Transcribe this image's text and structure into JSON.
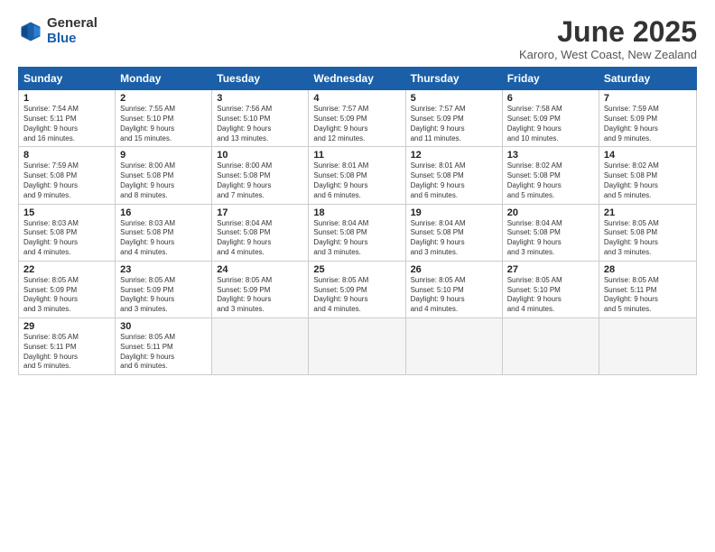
{
  "logo": {
    "general": "General",
    "blue": "Blue"
  },
  "title": "June 2025",
  "location": "Karoro, West Coast, New Zealand",
  "days": [
    "Sunday",
    "Monday",
    "Tuesday",
    "Wednesday",
    "Thursday",
    "Friday",
    "Saturday"
  ],
  "rows": [
    [
      {
        "num": "1",
        "lines": [
          "Sunrise: 7:54 AM",
          "Sunset: 5:11 PM",
          "Daylight: 9 hours",
          "and 16 minutes."
        ]
      },
      {
        "num": "2",
        "lines": [
          "Sunrise: 7:55 AM",
          "Sunset: 5:10 PM",
          "Daylight: 9 hours",
          "and 15 minutes."
        ]
      },
      {
        "num": "3",
        "lines": [
          "Sunrise: 7:56 AM",
          "Sunset: 5:10 PM",
          "Daylight: 9 hours",
          "and 13 minutes."
        ]
      },
      {
        "num": "4",
        "lines": [
          "Sunrise: 7:57 AM",
          "Sunset: 5:09 PM",
          "Daylight: 9 hours",
          "and 12 minutes."
        ]
      },
      {
        "num": "5",
        "lines": [
          "Sunrise: 7:57 AM",
          "Sunset: 5:09 PM",
          "Daylight: 9 hours",
          "and 11 minutes."
        ]
      },
      {
        "num": "6",
        "lines": [
          "Sunrise: 7:58 AM",
          "Sunset: 5:09 PM",
          "Daylight: 9 hours",
          "and 10 minutes."
        ]
      },
      {
        "num": "7",
        "lines": [
          "Sunrise: 7:59 AM",
          "Sunset: 5:09 PM",
          "Daylight: 9 hours",
          "and 9 minutes."
        ]
      }
    ],
    [
      {
        "num": "8",
        "lines": [
          "Sunrise: 7:59 AM",
          "Sunset: 5:08 PM",
          "Daylight: 9 hours",
          "and 9 minutes."
        ]
      },
      {
        "num": "9",
        "lines": [
          "Sunrise: 8:00 AM",
          "Sunset: 5:08 PM",
          "Daylight: 9 hours",
          "and 8 minutes."
        ]
      },
      {
        "num": "10",
        "lines": [
          "Sunrise: 8:00 AM",
          "Sunset: 5:08 PM",
          "Daylight: 9 hours",
          "and 7 minutes."
        ]
      },
      {
        "num": "11",
        "lines": [
          "Sunrise: 8:01 AM",
          "Sunset: 5:08 PM",
          "Daylight: 9 hours",
          "and 6 minutes."
        ]
      },
      {
        "num": "12",
        "lines": [
          "Sunrise: 8:01 AM",
          "Sunset: 5:08 PM",
          "Daylight: 9 hours",
          "and 6 minutes."
        ]
      },
      {
        "num": "13",
        "lines": [
          "Sunrise: 8:02 AM",
          "Sunset: 5:08 PM",
          "Daylight: 9 hours",
          "and 5 minutes."
        ]
      },
      {
        "num": "14",
        "lines": [
          "Sunrise: 8:02 AM",
          "Sunset: 5:08 PM",
          "Daylight: 9 hours",
          "and 5 minutes."
        ]
      }
    ],
    [
      {
        "num": "15",
        "lines": [
          "Sunrise: 8:03 AM",
          "Sunset: 5:08 PM",
          "Daylight: 9 hours",
          "and 4 minutes."
        ]
      },
      {
        "num": "16",
        "lines": [
          "Sunrise: 8:03 AM",
          "Sunset: 5:08 PM",
          "Daylight: 9 hours",
          "and 4 minutes."
        ]
      },
      {
        "num": "17",
        "lines": [
          "Sunrise: 8:04 AM",
          "Sunset: 5:08 PM",
          "Daylight: 9 hours",
          "and 4 minutes."
        ]
      },
      {
        "num": "18",
        "lines": [
          "Sunrise: 8:04 AM",
          "Sunset: 5:08 PM",
          "Daylight: 9 hours",
          "and 3 minutes."
        ]
      },
      {
        "num": "19",
        "lines": [
          "Sunrise: 8:04 AM",
          "Sunset: 5:08 PM",
          "Daylight: 9 hours",
          "and 3 minutes."
        ]
      },
      {
        "num": "20",
        "lines": [
          "Sunrise: 8:04 AM",
          "Sunset: 5:08 PM",
          "Daylight: 9 hours",
          "and 3 minutes."
        ]
      },
      {
        "num": "21",
        "lines": [
          "Sunrise: 8:05 AM",
          "Sunset: 5:08 PM",
          "Daylight: 9 hours",
          "and 3 minutes."
        ]
      }
    ],
    [
      {
        "num": "22",
        "lines": [
          "Sunrise: 8:05 AM",
          "Sunset: 5:09 PM",
          "Daylight: 9 hours",
          "and 3 minutes."
        ]
      },
      {
        "num": "23",
        "lines": [
          "Sunrise: 8:05 AM",
          "Sunset: 5:09 PM",
          "Daylight: 9 hours",
          "and 3 minutes."
        ]
      },
      {
        "num": "24",
        "lines": [
          "Sunrise: 8:05 AM",
          "Sunset: 5:09 PM",
          "Daylight: 9 hours",
          "and 3 minutes."
        ]
      },
      {
        "num": "25",
        "lines": [
          "Sunrise: 8:05 AM",
          "Sunset: 5:09 PM",
          "Daylight: 9 hours",
          "and 4 minutes."
        ]
      },
      {
        "num": "26",
        "lines": [
          "Sunrise: 8:05 AM",
          "Sunset: 5:10 PM",
          "Daylight: 9 hours",
          "and 4 minutes."
        ]
      },
      {
        "num": "27",
        "lines": [
          "Sunrise: 8:05 AM",
          "Sunset: 5:10 PM",
          "Daylight: 9 hours",
          "and 4 minutes."
        ]
      },
      {
        "num": "28",
        "lines": [
          "Sunrise: 8:05 AM",
          "Sunset: 5:11 PM",
          "Daylight: 9 hours",
          "and 5 minutes."
        ]
      }
    ],
    [
      {
        "num": "29",
        "lines": [
          "Sunrise: 8:05 AM",
          "Sunset: 5:11 PM",
          "Daylight: 9 hours",
          "and 5 minutes."
        ]
      },
      {
        "num": "30",
        "lines": [
          "Sunrise: 8:05 AM",
          "Sunset: 5:11 PM",
          "Daylight: 9 hours",
          "and 6 minutes."
        ]
      },
      {
        "num": "",
        "lines": []
      },
      {
        "num": "",
        "lines": []
      },
      {
        "num": "",
        "lines": []
      },
      {
        "num": "",
        "lines": []
      },
      {
        "num": "",
        "lines": []
      }
    ]
  ]
}
